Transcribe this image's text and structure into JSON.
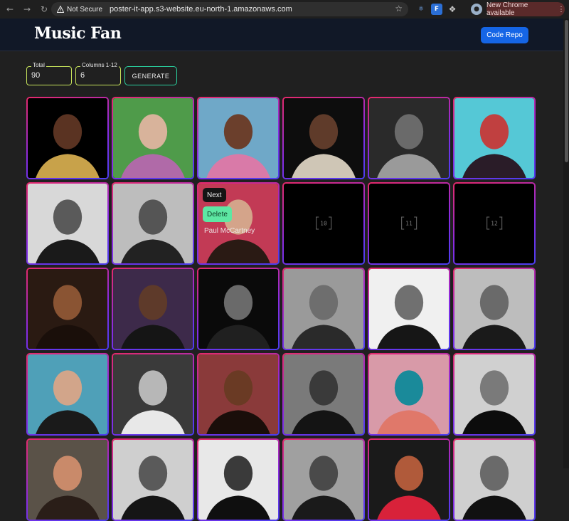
{
  "browser": {
    "security_label": "Not Secure",
    "url": "poster-it-app.s3-website.eu-north-1.amazonaws.com",
    "badge": "New Chrome available",
    "ext_label": "F"
  },
  "header": {
    "brand": "Music Fan",
    "code_repo_label": "Code Repo"
  },
  "controls": {
    "total_label": "Total",
    "total_value": "90",
    "columns_label": "Columns 1-12",
    "columns_value": "6",
    "generate_label": "GENERATE"
  },
  "grid": {
    "hover_next_label": "Next",
    "hover_delete_label": "Delete",
    "hover_name": "Paul McCartney",
    "tiles": [
      {
        "kind": "photo",
        "bg": "#000000",
        "skin": "#5a3322",
        "accent": "#c8a24a"
      },
      {
        "kind": "photo",
        "bg": "#4f9b4a",
        "skin": "#d8b39b",
        "accent": "#b06aa8"
      },
      {
        "kind": "photo",
        "bg": "#6fa8c8",
        "skin": "#6b3f2c",
        "accent": "#d97aa8"
      },
      {
        "kind": "photo",
        "bg": "#0d0d0d",
        "skin": "#5f3b2a",
        "accent": "#cfc6b6"
      },
      {
        "kind": "photo",
        "bg": "#2a2a2a",
        "skin": "#6a6a6a",
        "accent": "#9a9a9a"
      },
      {
        "kind": "photo",
        "bg": "#55c8d6",
        "skin": "#c04040",
        "accent": "#2a1c28"
      },
      {
        "kind": "photo",
        "bg": "#d8d8d8",
        "skin": "#5a5a5a",
        "accent": "#1a1a1a"
      },
      {
        "kind": "photo",
        "bg": "#bdbdbd",
        "skin": "#555555",
        "accent": "#222222"
      },
      {
        "kind": "hover",
        "bg": "#c23a55",
        "skin": "#d4a48a",
        "accent": "#2a1a14"
      },
      {
        "kind": "empty",
        "label": "10"
      },
      {
        "kind": "empty",
        "label": "11"
      },
      {
        "kind": "empty",
        "label": "12"
      },
      {
        "kind": "photo",
        "bg": "#2a1a12",
        "skin": "#8a5433",
        "accent": "#1a0f0a"
      },
      {
        "kind": "photo",
        "bg": "#3d2a4a",
        "skin": "#5e3a2a",
        "accent": "#151515"
      },
      {
        "kind": "photo",
        "bg": "#0a0a0a",
        "skin": "#6a6a6a",
        "accent": "#202020"
      },
      {
        "kind": "photo",
        "bg": "#9a9a9a",
        "skin": "#6e6e6e",
        "accent": "#2a2a2a"
      },
      {
        "kind": "photo",
        "bg": "#f0f0f0",
        "skin": "#707070",
        "accent": "#161616"
      },
      {
        "kind": "photo",
        "bg": "#bdbdbd",
        "skin": "#6a6a6a",
        "accent": "#1a1a1a"
      },
      {
        "kind": "photo",
        "bg": "#4fa0b8",
        "skin": "#d2a58a",
        "accent": "#1a1a1a"
      },
      {
        "kind": "photo",
        "bg": "#3a3a3a",
        "skin": "#b7b7b7",
        "accent": "#e8e8e8"
      },
      {
        "kind": "photo",
        "bg": "#8a3a3a",
        "skin": "#6a3a24",
        "accent": "#1a0e0a"
      },
      {
        "kind": "photo",
        "bg": "#7a7a7a",
        "skin": "#3a3a3a",
        "accent": "#141414"
      },
      {
        "kind": "photo",
        "bg": "#d89aa8",
        "skin": "#1a8a9a",
        "accent": "#e0786a"
      },
      {
        "kind": "photo",
        "bg": "#d0d0d0",
        "skin": "#7a7a7a",
        "accent": "#0c0c0c"
      },
      {
        "kind": "photo",
        "bg": "#5a5248",
        "skin": "#c98a6a",
        "accent": "#2a1e18"
      },
      {
        "kind": "photo",
        "bg": "#cfcfcf",
        "skin": "#5a5a5a",
        "accent": "#151515"
      },
      {
        "kind": "photo",
        "bg": "#e8e8e8",
        "skin": "#3a3a3a",
        "accent": "#0f0f0f"
      },
      {
        "kind": "photo",
        "bg": "#a0a0a0",
        "skin": "#4a4a4a",
        "accent": "#1a1a1a"
      },
      {
        "kind": "photo",
        "bg": "#1a1a1a",
        "skin": "#b05a3a",
        "accent": "#d8223a"
      },
      {
        "kind": "photo",
        "bg": "#cfcfcf",
        "skin": "#6a6a6a",
        "accent": "#111111"
      }
    ]
  }
}
